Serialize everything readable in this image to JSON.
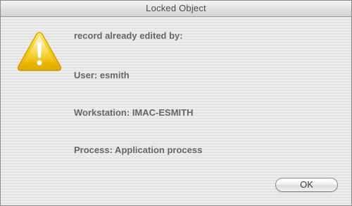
{
  "window": {
    "title": "Locked Object"
  },
  "icon": {
    "name": "warning-icon",
    "color": "#f5c400"
  },
  "message": {
    "heading": "record already edited by:",
    "user": "User: esmith",
    "workstation": "Workstation: IMAC-ESMITH",
    "process": "Process: Application process"
  },
  "buttons": {
    "ok_label": "OK"
  }
}
